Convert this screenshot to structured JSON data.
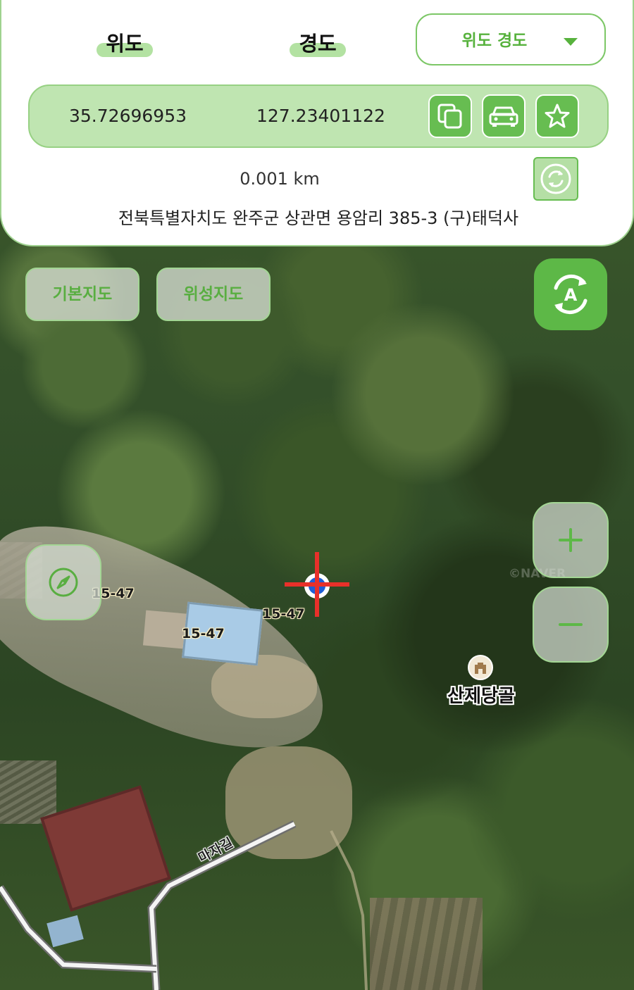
{
  "header": {
    "lat_label": "위도",
    "lng_label": "경도",
    "format_select": {
      "value": "위도 경도"
    }
  },
  "coordinates": {
    "latitude": "35.72696953",
    "longitude": "127.23401122"
  },
  "actions": {
    "copy_icon": "copy-icon",
    "car_icon": "car-icon",
    "star_icon": "star-icon",
    "refresh_icon": "refresh-icon"
  },
  "distance": "0.001 km",
  "address": "전북특별자치도 완주군 상관면 용암리 385-3 (구)태덕사",
  "map_controls": {
    "basic_map": "기본지도",
    "satellite_map": "위성지도",
    "auto_icon": "auto-rotate-icon",
    "auto_letter": "A",
    "compass_icon": "compass-icon",
    "zoom_in_icon": "plus-icon",
    "zoom_out_icon": "minus-icon"
  },
  "map_labels": {
    "parcels": [
      "15-47",
      "15-47",
      "15-47"
    ],
    "poi": "산제당골",
    "road": "마자길",
    "watermark": "©NAVER"
  },
  "colors": {
    "accent": "#5db847",
    "accent_light": "#bfe5b1",
    "crosshair": "#e8302a",
    "location": "#1f5fd6"
  }
}
